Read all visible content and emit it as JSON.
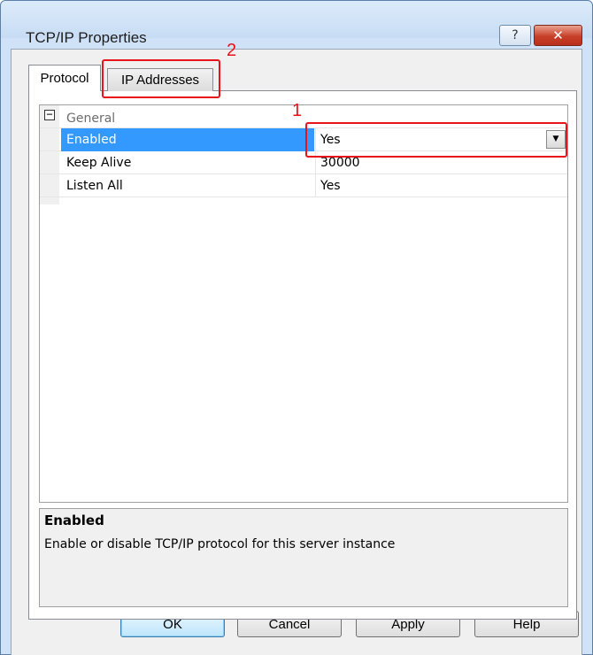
{
  "window": {
    "title": "TCP/IP Properties",
    "help_glyph": "?",
    "close_glyph": "✕"
  },
  "tabs": [
    {
      "label": "Protocol",
      "selected": true
    },
    {
      "label": "IP Addresses",
      "selected": false
    }
  ],
  "property_grid": {
    "category": {
      "label": "General",
      "expanded": true,
      "toggle_glyph": "⊟"
    },
    "rows": [
      {
        "name": "Enabled",
        "value": "Yes",
        "selected": true,
        "dropdown_glyph": "▼"
      },
      {
        "name": "Keep Alive",
        "value": "30000",
        "selected": false
      },
      {
        "name": "Listen All",
        "value": "Yes",
        "selected": false
      }
    ]
  },
  "description": {
    "title": "Enabled",
    "text": "Enable or disable TCP/IP protocol for this server instance"
  },
  "buttons": {
    "ok": "OK",
    "cancel": "Cancel",
    "apply": "Apply",
    "help": "Help"
  },
  "annotations": [
    {
      "number": "1",
      "target": "enabled-value-dropdown",
      "color": "#e8131b"
    },
    {
      "number": "2",
      "target": "tab-ip-addresses",
      "color": "#e8131b"
    }
  ],
  "colors": {
    "selection": "#3399ff",
    "window_frame": "#cfe2f7",
    "annotation": "#e8131b"
  }
}
